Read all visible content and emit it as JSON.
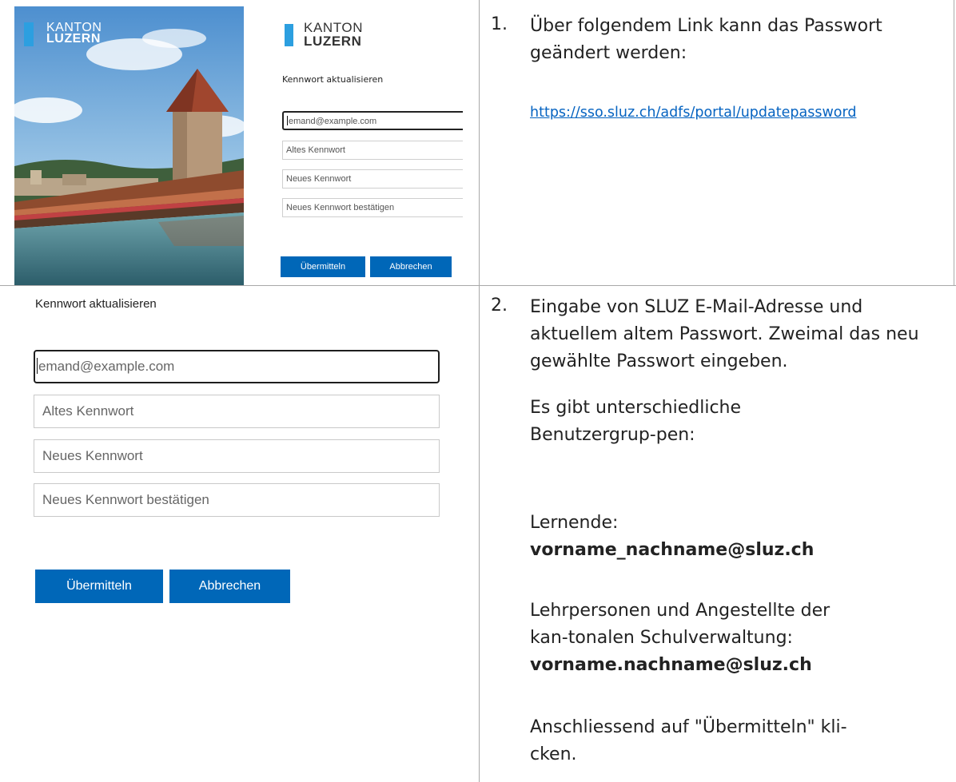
{
  "logo": {
    "line1": "KANTON",
    "line2": "LUZERN"
  },
  "form": {
    "heading": "Kennwort aktualisieren",
    "email_placeholder": "jemand@example.com",
    "email_placeholder_rest": "emand@example.com",
    "old_password_placeholder": "Altes Kennwort",
    "new_password_placeholder": "Neues Kennwort",
    "confirm_password_placeholder": "Neues Kennwort bestätigen",
    "submit_label": "Übermitteln",
    "cancel_label": "Abbrechen"
  },
  "steps": [
    {
      "number": "1.",
      "text": "Über folgendem Link kann das Passwort geändert werden:",
      "link": "https://sso.sluz.ch/adfs/portal/updatepassword"
    },
    {
      "number": "2.",
      "intro": "Eingabe von SLUZ E-Mail-Adresse und aktuellem altem Passwort. Zweimal das neu gewählte Passwort eingeben.",
      "groups_intro": "Es gibt unterschiedliche Benutzergrup-pen:",
      "learners_label": "Lernende:",
      "learners_email": "vorname_nachname@sluz.ch",
      "staff_label": "Lehrpersonen und Angestellte der kan-tonalen Schulverwaltung:",
      "staff_email": "vorname.nachname@sluz.ch",
      "final": "Anschliessend auf \"Übermitteln\" kli-cken."
    }
  ],
  "colors": {
    "accent": "#0067b8",
    "logo_blue": "#2c9fe0",
    "link": "#0563c1",
    "grid": "#a9a9a9"
  }
}
